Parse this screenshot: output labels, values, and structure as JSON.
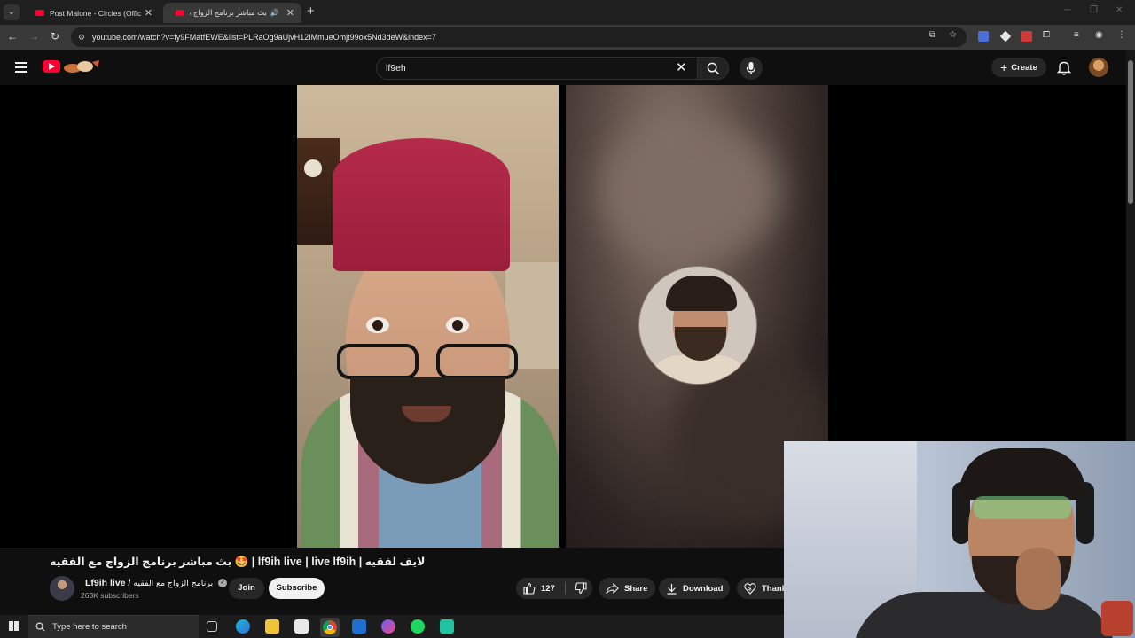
{
  "browser": {
    "tabs": [
      {
        "title": "Post Malone - Circles (Official M",
        "active": false
      },
      {
        "title": "بث مباشر برنامج الزواج مع الف",
        "active": true,
        "audio_icon": "speaker-icon"
      }
    ],
    "new_tab_label": "+",
    "url": "youtube.com/watch?v=fy9FMatfEWE&list=PLRaOg9aUjvH12IMmueOmjt99ox5Nd3deW&index=7"
  },
  "youtube": {
    "search_value": "lf9eh",
    "create_label": "Create",
    "brand_color": "#ff0033"
  },
  "video": {
    "title": "لايف لفقيه | lf9ih live | live lf9ih | 🤩 بث مباشر برنامج الزواج مع الفقيه",
    "channel_name": "Lf9ih live /",
    "channel_name_ar": "برنامج الزواج مع الفقيه",
    "subscribers": "263K subscribers",
    "join_label": "Join",
    "subscribe_label": "Subscribe",
    "likes": "127",
    "share_label": "Share",
    "download_label": "Download",
    "thanks_label": "Thank"
  },
  "taskbar": {
    "search_placeholder": "Type here to search",
    "icons": [
      "windows-start-icon",
      "task-view-icon",
      "edge-icon",
      "file-explorer-icon",
      "store-icon",
      "chrome-icon",
      "outlook-icon",
      "messenger-icon",
      "spotify-icon",
      "app-icon"
    ]
  }
}
